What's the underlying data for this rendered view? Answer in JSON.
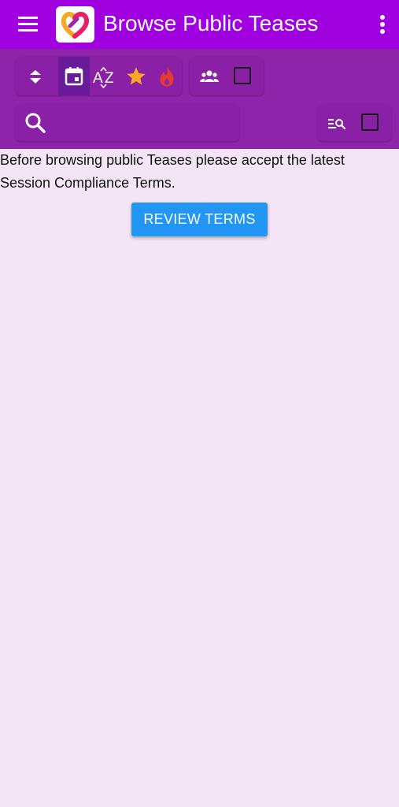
{
  "app_bar": {
    "title": "Browse Public Teases",
    "menu_icon": "hamburger-menu-icon",
    "logo_icon": "heart-logo-icon",
    "more_icon": "more-vertical-icon"
  },
  "toolbar": {
    "sort_buttons": [
      {
        "icon": "sort-direction-icon",
        "active": false
      },
      {
        "icon": "calendar-icon",
        "active": true
      },
      {
        "icon": "sort-alpha-icon",
        "active": false
      },
      {
        "icon": "star-icon",
        "active": false
      },
      {
        "icon": "flame-icon",
        "active": false
      }
    ],
    "filter_icon": "people-icon",
    "filter_checked": false,
    "search": {
      "value": "",
      "placeholder": "",
      "icon": "search-icon"
    },
    "search_options_icon": "search-list-icon",
    "search_options_checked": false
  },
  "content": {
    "notice": "Before browsing public Teases please accept the latest Session Compliance Terms.",
    "review_button": "REVIEW TERMS"
  },
  "colors": {
    "app_bar": "#a000e0",
    "toolbar": "#8e24aa",
    "background": "#f3e5f5",
    "button": "#2196f3",
    "star": "#f9a825",
    "flame": "#e53935"
  }
}
